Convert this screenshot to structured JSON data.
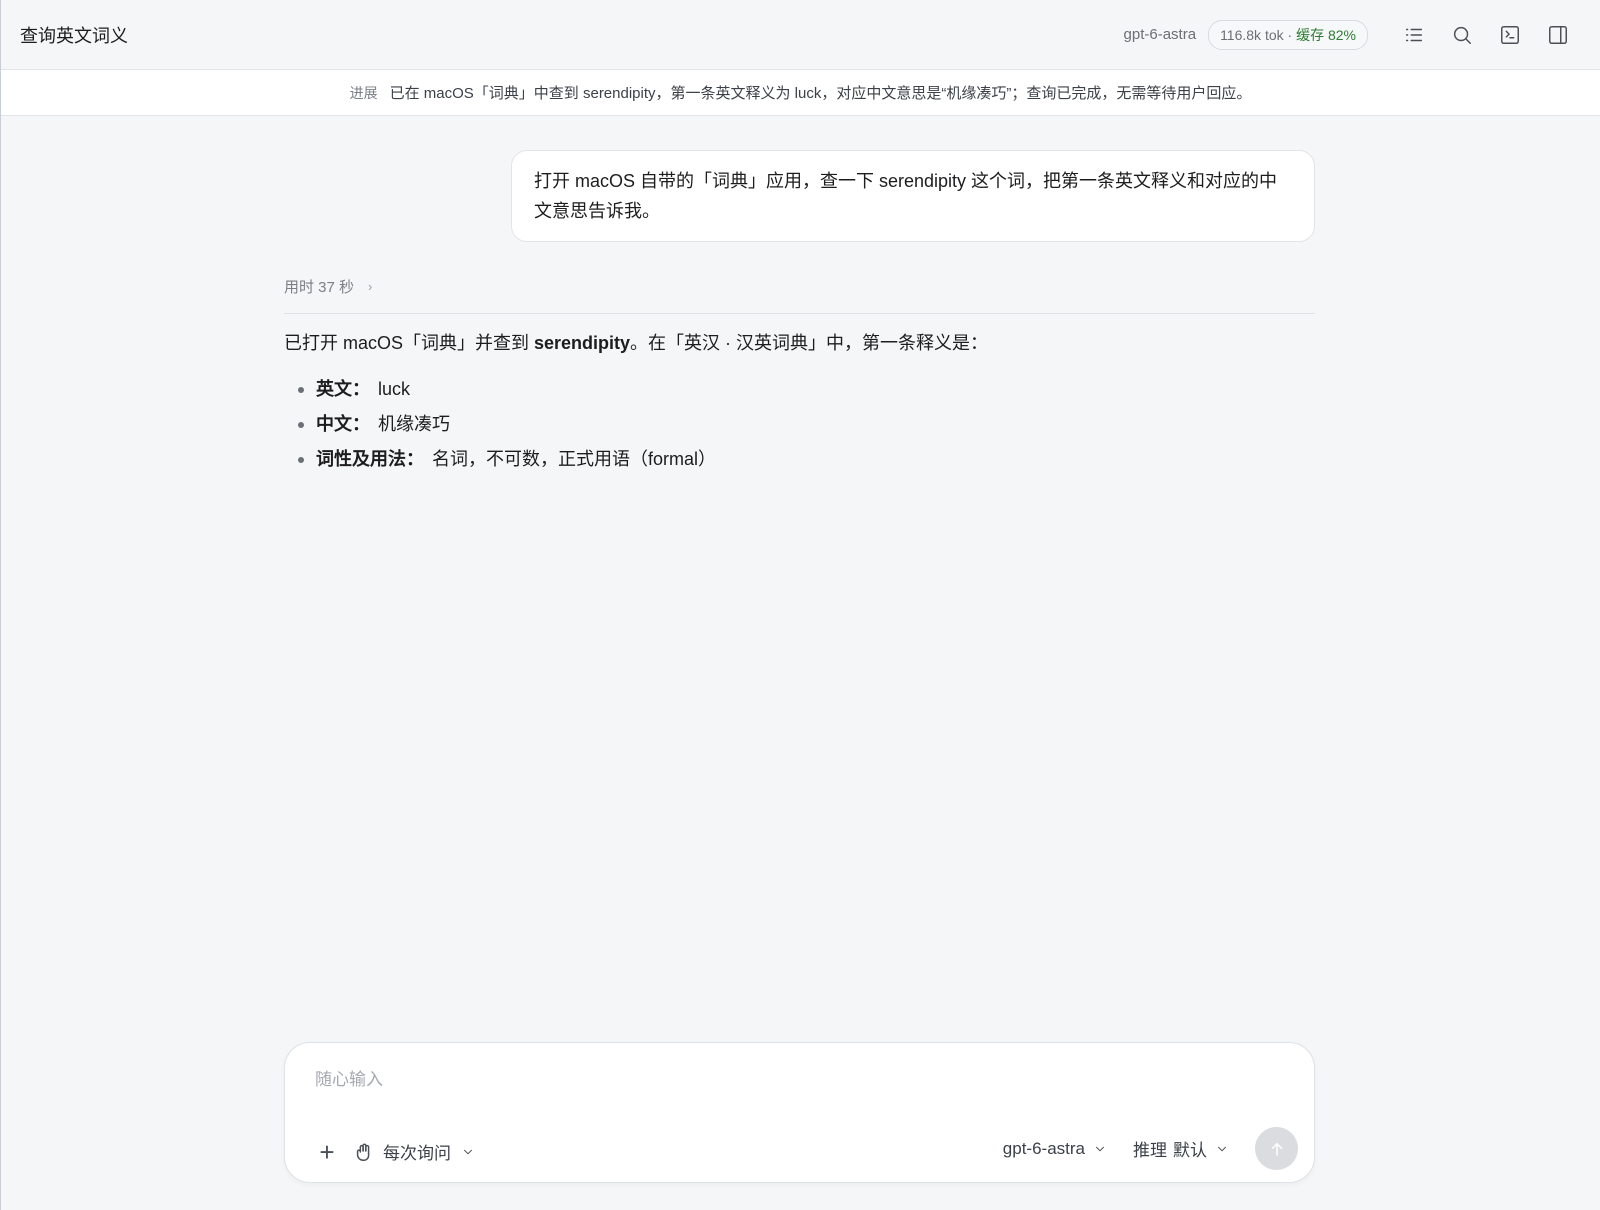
{
  "header": {
    "title": "查询英文词义",
    "model": "gpt-6-astra",
    "tokens": "116.8k tok · ",
    "cache": "缓存 82%",
    "icons": [
      "list-icon",
      "search-icon",
      "terminal-icon",
      "sidebar-icon"
    ]
  },
  "progress": {
    "label": "进展",
    "text": "已在 macOS「词典」中查到 serendipity，第一条英文释义为 luck，对应中文意思是“机缘凑巧”；查询已完成，无需等待用户回应。"
  },
  "user_message": "打开 macOS 自带的「词典」应用，查一下 serendipity 这个词，把第一条英文释义和对应的中文意思告诉我。",
  "timing": {
    "label": "用时 37 秒",
    "chevron": "›"
  },
  "answer": {
    "lead_before": "已打开 macOS「词典」并查到 ",
    "lead_bold": "serendipity",
    "lead_after": "。在「英汉 · 汉英词典」中，第一条释义是：",
    "items": [
      {
        "key": "英文：",
        "value": "luck"
      },
      {
        "key": "中文：",
        "value": "机缘凑巧"
      },
      {
        "key": "词性及用法：",
        "value": "名词，不可数，正式用语（formal）"
      }
    ]
  },
  "composer": {
    "placeholder": "随心输入",
    "plus": "+",
    "mode_label": "每次询问",
    "model_label": "gpt-6-astra",
    "reasoning_label": "推理",
    "reasoning_value": "默认"
  },
  "colors": {
    "background": "#f5f6f8",
    "cache_green": "#2e7d32",
    "send_disabled": "#dadce0"
  }
}
